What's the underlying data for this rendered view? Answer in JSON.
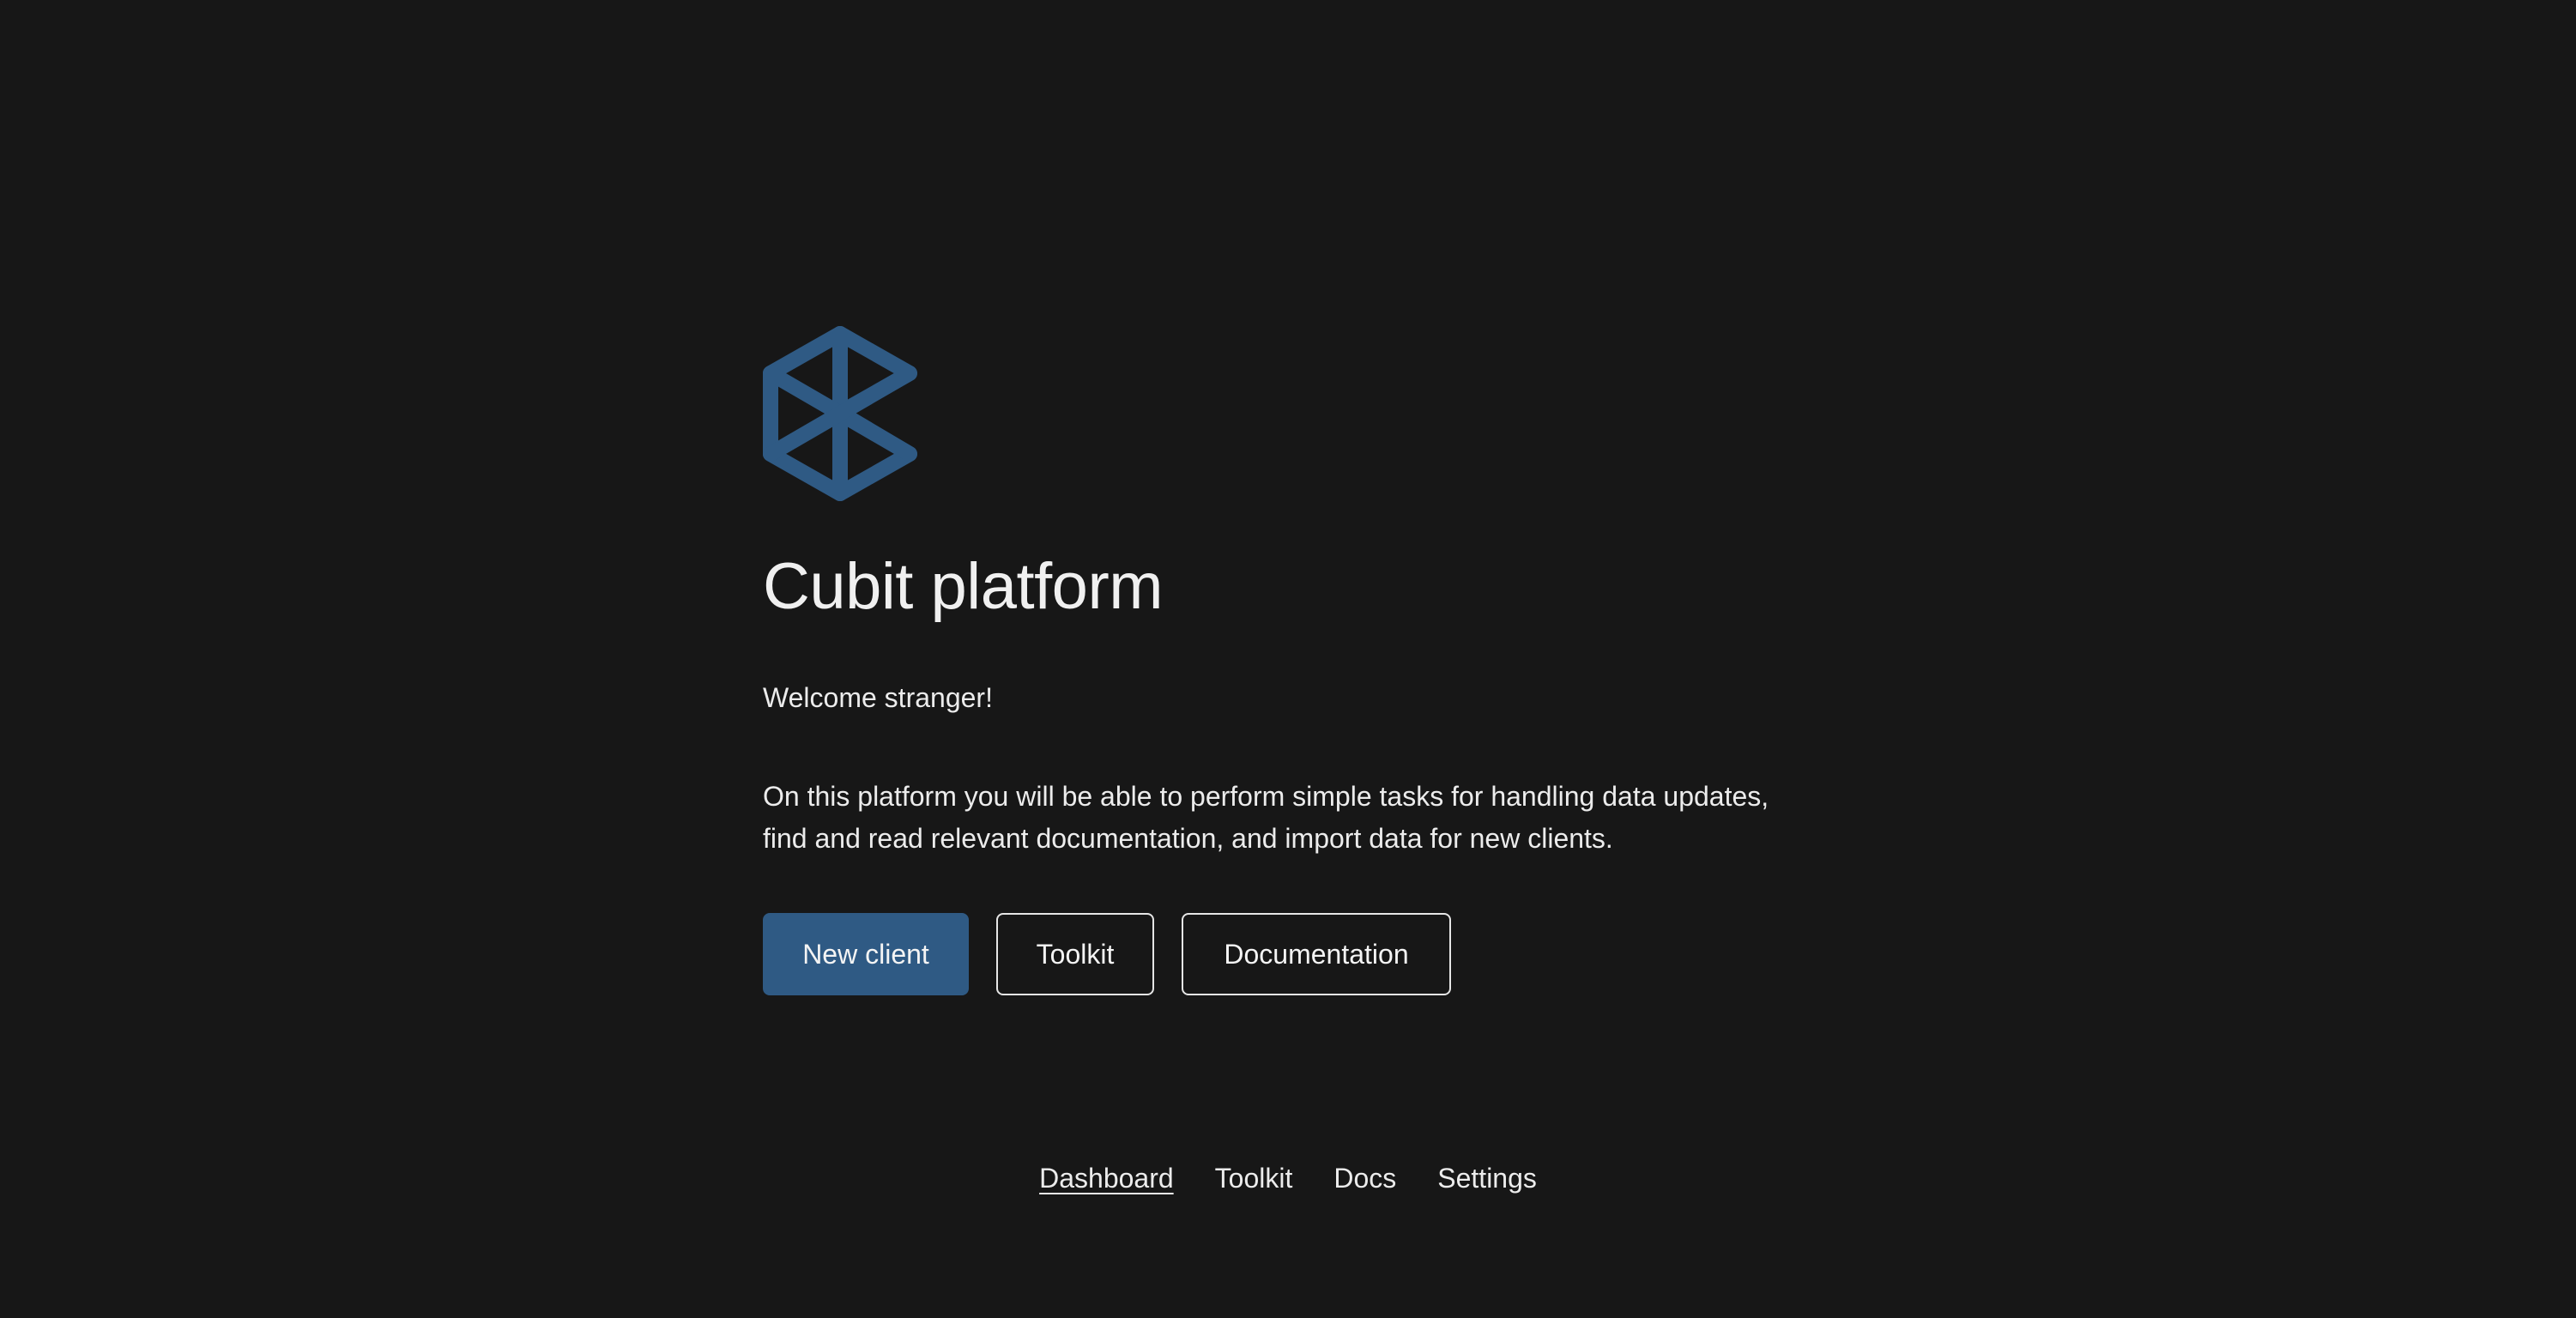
{
  "brand": {
    "logo_icon": "hexagon-cube-logo-icon",
    "accent_color": "#2f5a84"
  },
  "hero": {
    "title": "Cubit platform",
    "welcome": "Welcome stranger!",
    "description_lines": [
      "On this platform you will be able to perform simple tasks for handling data updates,",
      "find and read relevant documentation, and import data for new clients."
    ]
  },
  "actions": {
    "new_client": "New client",
    "toolkit": "Toolkit",
    "documentation": "Documentation"
  },
  "footer_nav": {
    "items": [
      {
        "label": "Dashboard",
        "active": true
      },
      {
        "label": "Toolkit",
        "active": false
      },
      {
        "label": "Docs",
        "active": false
      },
      {
        "label": "Settings",
        "active": false
      }
    ]
  }
}
